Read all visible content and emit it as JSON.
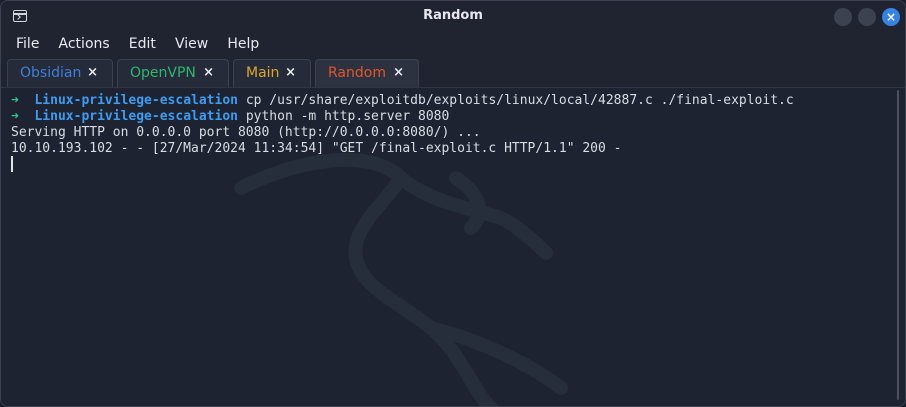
{
  "window": {
    "title": "Random"
  },
  "menu": [
    "File",
    "Actions",
    "Edit",
    "View",
    "Help"
  ],
  "tabs": [
    {
      "label": "Obsidian",
      "color": "#3d7fd9",
      "active": false
    },
    {
      "label": "OpenVPN",
      "color": "#2fb672",
      "active": false
    },
    {
      "label": "Main",
      "color": "#e1a52b",
      "active": false
    },
    {
      "label": "Random",
      "color": "#e4552a",
      "active": true
    }
  ],
  "tab_close_glyph": "×",
  "terminal": {
    "prompt_symbol": "➜",
    "lines": [
      {
        "dir": "Linux-privilege-escalation",
        "command": "cp /usr/share/exploitdb/exploits/linux/local/42887.c ./final-exploit.c"
      },
      {
        "dir": "Linux-privilege-escalation",
        "command": "python -m http.server 8080"
      }
    ],
    "output": [
      "Serving HTTP on 0.0.0.0 port 8080 (http://0.0.0.0:8080/) ...",
      "10.10.193.102 - - [27/Mar/2024 11:34:54] \"GET /final-exploit.c HTTP/1.1\" 200 -"
    ]
  },
  "colors": {
    "background": "#1d2330",
    "prompt_arrow": "#35c58a",
    "prompt_dir": "#3d9cf0",
    "text": "#d8dce4",
    "close_button": "#3584e4"
  }
}
